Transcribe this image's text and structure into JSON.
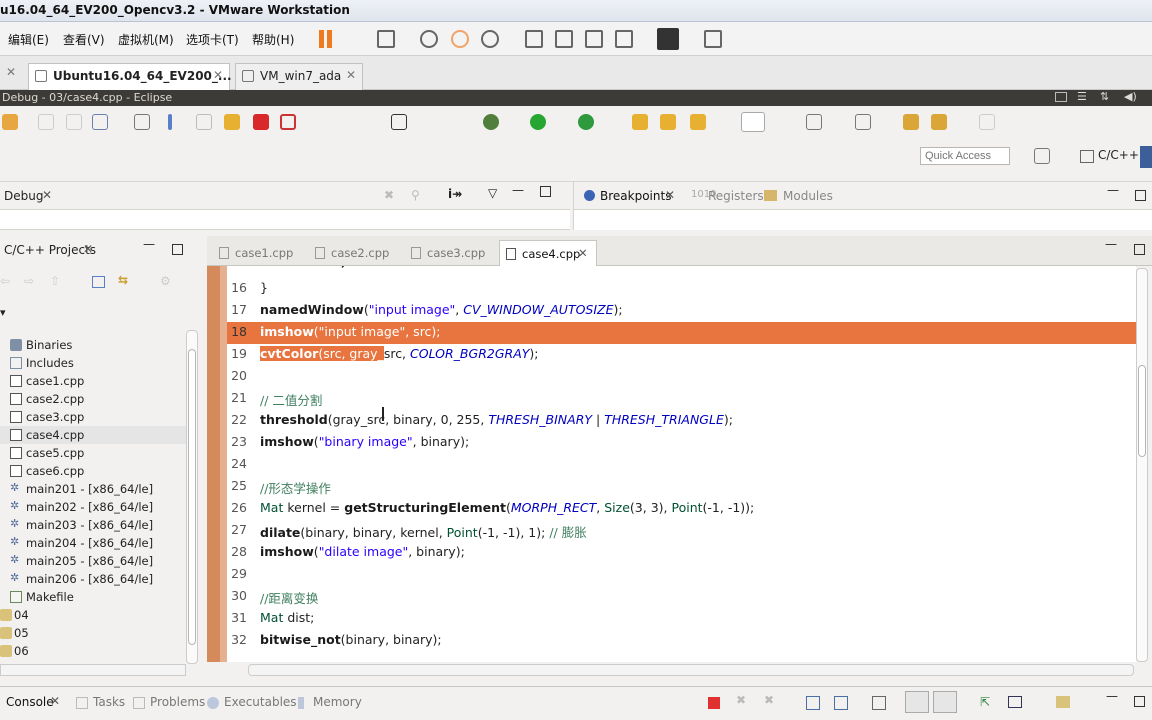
{
  "vm": {
    "title": "u16.04_64_EV200_Opencv3.2 - VMware Workstation",
    "menu": [
      {
        "label": "编辑(E)"
      },
      {
        "label": "查看(V)"
      },
      {
        "label": "虚拟机(M)"
      },
      {
        "label": "选项卡(T)"
      },
      {
        "label": "帮助(H)"
      }
    ],
    "tabs": [
      {
        "label": "Ubuntu16.04_64_EV200_..."
      },
      {
        "label": "VM_win7_ada"
      }
    ]
  },
  "ubuntu_bar": {
    "title": "Debug - 03/case4.cpp - Eclipse"
  },
  "eclipse": {
    "quick_access_placeholder": "Quick Access",
    "perspective_label": "C/C++",
    "debug_view": {
      "label": "Debug"
    },
    "breakpoints_tabs": [
      {
        "label": "Breakpoints"
      },
      {
        "label": "Registers"
      },
      {
        "label": "Modules"
      }
    ],
    "projects_view": {
      "label": "C/C++ Projects"
    },
    "tree": [
      {
        "label": "Binaries",
        "icon": "binaries-icon"
      },
      {
        "label": "Includes",
        "icon": "includes-icon"
      },
      {
        "label": "case1.cpp",
        "icon": "cpp-file-icon"
      },
      {
        "label": "case2.cpp",
        "icon": "cpp-file-icon"
      },
      {
        "label": "case3.cpp",
        "icon": "cpp-file-icon"
      },
      {
        "label": "case4.cpp",
        "icon": "cpp-file-icon"
      },
      {
        "label": "case5.cpp",
        "icon": "cpp-file-icon"
      },
      {
        "label": "case6.cpp",
        "icon": "cpp-file-icon"
      },
      {
        "label": "main201 - [x86_64/le]",
        "icon": "executable-icon"
      },
      {
        "label": "main202 - [x86_64/le]",
        "icon": "executable-icon"
      },
      {
        "label": "main203 - [x86_64/le]",
        "icon": "executable-icon"
      },
      {
        "label": "main204 - [x86_64/le]",
        "icon": "executable-icon"
      },
      {
        "label": "main205 - [x86_64/le]",
        "icon": "executable-icon"
      },
      {
        "label": "main206 - [x86_64/le]",
        "icon": "executable-icon"
      },
      {
        "label": "Makefile",
        "icon": "makefile-icon"
      },
      {
        "label": "04",
        "icon": "folder-icon"
      },
      {
        "label": "05",
        "icon": "folder-icon"
      },
      {
        "label": "06",
        "icon": "folder-icon"
      }
    ],
    "editor_tabs": [
      {
        "label": "case1.cpp"
      },
      {
        "label": "case2.cpp"
      },
      {
        "label": "case3.cpp"
      },
      {
        "label": "case4.cpp"
      }
    ],
    "code_lines": [
      {
        "n": "16",
        "text": "}"
      },
      {
        "n": "17",
        "text": "namedWindow(\"input image\", CV_WINDOW_AUTOSIZE);"
      },
      {
        "n": "18",
        "text": "imshow(\"input image\", src);"
      },
      {
        "n": "19",
        "text": "cvtColor(src, gray_src, COLOR_BGR2GRAY);"
      },
      {
        "n": "20",
        "text": ""
      },
      {
        "n": "21",
        "text": "// 二值分割"
      },
      {
        "n": "22",
        "text": "threshold(gray_src, binary, 0, 255, THRESH_BINARY | THRESH_TRIANGLE);"
      },
      {
        "n": "23",
        "text": "imshow(\"binary image\", binary);"
      },
      {
        "n": "24",
        "text": ""
      },
      {
        "n": "25",
        "text": "//形态学操作"
      },
      {
        "n": "26",
        "text": "Mat kernel = getStructuringElement(MORPH_RECT, Size(3, 3), Point(-1, -1));"
      },
      {
        "n": "27",
        "text": "dilate(binary, binary, kernel, Point(-1, -1), 1); // 膨胀"
      },
      {
        "n": "28",
        "text": "imshow(\"dilate image\", binary);"
      },
      {
        "n": "29",
        "text": ""
      },
      {
        "n": "30",
        "text": "//距离变换"
      },
      {
        "n": "31",
        "text": "Mat dist;"
      },
      {
        "n": "32",
        "text": "bitwise_not(binary, binary);"
      }
    ],
    "console_tabs": [
      {
        "label": "Console"
      },
      {
        "label": "Tasks"
      },
      {
        "label": "Problems"
      },
      {
        "label": "Executables"
      },
      {
        "label": "Memory"
      }
    ]
  },
  "colors": {
    "highlight": "#e8753f",
    "ubuntu_bar": "#3c3b37",
    "gutter": "#d48a5a"
  }
}
